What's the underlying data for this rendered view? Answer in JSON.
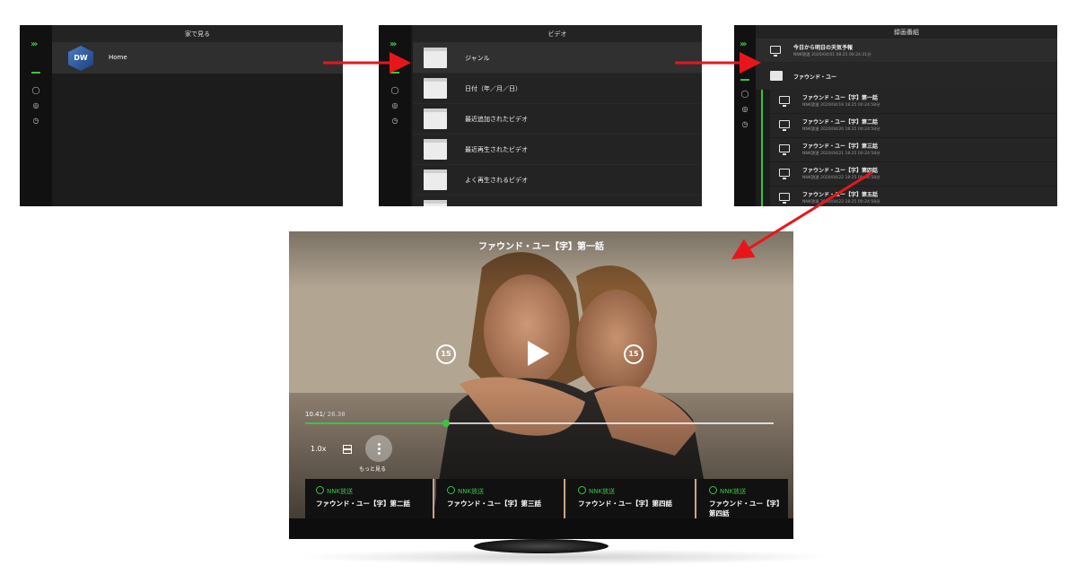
{
  "screen1": {
    "title": "家で見る",
    "home_label": "Home",
    "logo_text": "DW"
  },
  "screen2": {
    "title": "ビデオ",
    "items": [
      {
        "label": "ジャンル"
      },
      {
        "label": "日付（年／月／日）"
      },
      {
        "label": "最近追加されたビデオ"
      },
      {
        "label": "最近再生されたビデオ"
      },
      {
        "label": "よく再生されるビデオ"
      }
    ]
  },
  "screen3": {
    "title": "録画番組",
    "top_item": {
      "title": "今日から明日の天気予報",
      "sub": "NNK放送 2020/04/01 08:25 00:24:31分"
    },
    "folder_label": "ファウンド・ユー",
    "episodes": [
      {
        "title": "ファウンド・ユー【字】第一話",
        "sub": "NNK放送 2020/04/19 18:25 00:24:58分"
      },
      {
        "title": "ファウンド・ユー【字】第二話",
        "sub": "NNK放送 2020/04/20 18:25 00:24:58分"
      },
      {
        "title": "ファウンド・ユー【字】第三話",
        "sub": "NNK放送 2020/04/21 18:25 00:24:58分"
      },
      {
        "title": "ファウンド・ユー【字】第四話",
        "sub": "NNK放送 2020/04/22 18:25 00:24:58分"
      },
      {
        "title": "ファウンド・ユー【字】第五話",
        "sub": "NNK放送 2020/04/23 18:25 00:24:58分"
      }
    ]
  },
  "player": {
    "title": "ファウンド・ユー【字】第一話",
    "skip_back": "15",
    "skip_forward": "15",
    "time_current": "10.41",
    "time_total": "/ 26.38",
    "progress": 0.3,
    "speed": "1.0x",
    "more_label": "もっと見る",
    "cards": [
      {
        "channel": "NNK放送",
        "episode": "ファウンド・ユー【字】第二話"
      },
      {
        "channel": "NNK放送",
        "episode": "ファウンド・ユー【字】第三話"
      },
      {
        "channel": "NNK放送",
        "episode": "ファウンド・ユー【字】第四話"
      },
      {
        "channel": "NNK放送",
        "episode": "ファウンド・ユー【字】第四話"
      }
    ]
  },
  "colors": {
    "accent": "#39c443",
    "arrow": "#e8161b",
    "panel_bg": "#1c1c1c"
  }
}
